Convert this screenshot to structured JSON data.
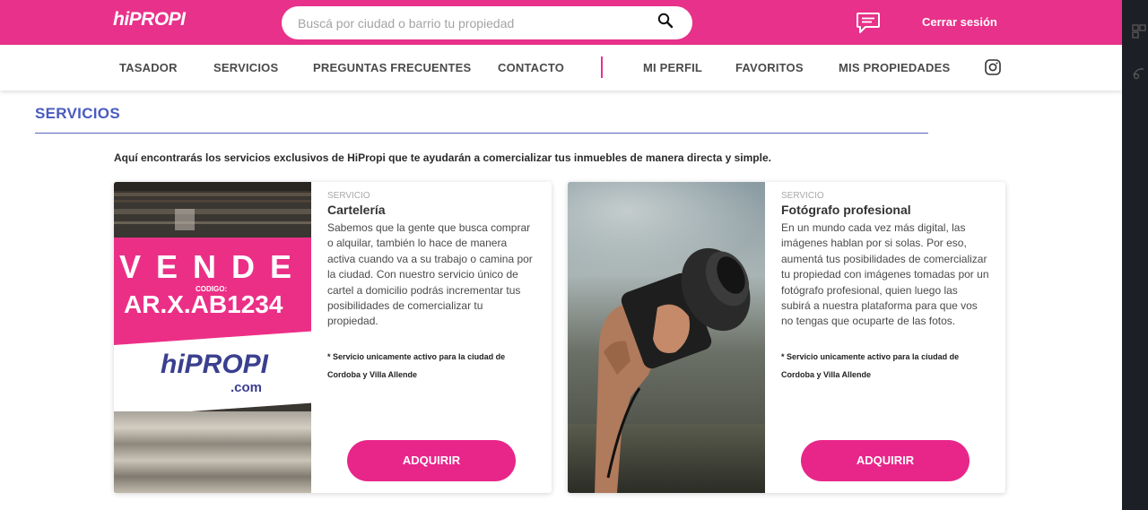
{
  "header": {
    "logo": "hiPROPI",
    "search_placeholder": "Buscá por ciudad o barrio tu propiedad",
    "logout": "Cerrar sesión"
  },
  "nav": {
    "left": [
      "TASADOR",
      "SERVICIOS",
      "PREGUNTAS FRECUENTES",
      "CONTACTO"
    ],
    "right": [
      "MI PERFIL",
      "FAVORITOS",
      "MIS PROPIEDADES"
    ]
  },
  "page": {
    "title": "SERVICIOS",
    "intro": "Aquí encontrarás los servicios exclusivos de HiPropi que te ayudarán a comercializar tus inmuebles de manera directa y simple."
  },
  "cards": [
    {
      "kicker": "SERVICIO",
      "title": "Cartelería",
      "description": "Sabemos que la gente que busca comprar o alquilar, también lo hace de manera activa cuando va a su trabajo o camina por la ciudad. Con nuestro servicio único de cartel a domicilio podrás incrementar tus posibilidades de comercializar tu propiedad.",
      "note": "* Servicio unicamente activo para la ciudad de Cordoba y Villa Allende",
      "button": "ADQUIRIR",
      "image": {
        "word": "VENDE",
        "code_label": "CODIGO:",
        "code": "AR.X.AB1234",
        "brand": "hiPROPI",
        "domain": ".com"
      }
    },
    {
      "kicker": "SERVICIO",
      "title": "Fotógrafo profesional",
      "description": "En un mundo cada vez más digital, las imágenes hablan por si solas. Por eso, aumentá tus posibilidades de comercializar tu propiedad con imágenes tomadas por un fotógrafo profesional, quien luego las subirá a nuestra plataforma para que vos no tengas que ocuparte de las fotos.",
      "note": "* Servicio unicamente activo para la ciudad de Cordoba y Villa Allende",
      "button": "ADQUIRIR"
    }
  ],
  "colors": {
    "brand_pink": "#e8318a",
    "title_blue": "#4a5bbf"
  }
}
